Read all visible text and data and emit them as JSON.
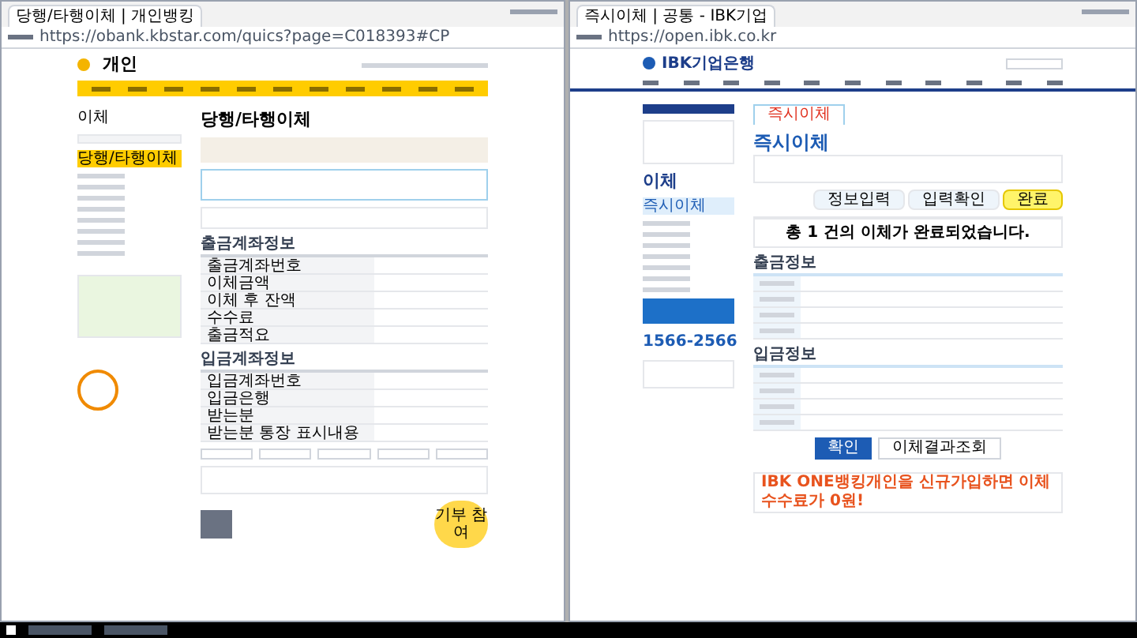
{
  "left_window": {
    "tab_title": "당행/타행이체 | 개인뱅킹",
    "url": "https://obank.kbstar.com/quics?page=C018393#CP",
    "logo": "개인",
    "sidebar_title": "이체",
    "sidebar_items": [
      {
        "label": "당행/타행이체",
        "selected": true
      }
    ],
    "page_title": "당행/타행이체",
    "withdraw": {
      "title": "출금계좌정보",
      "rows": [
        "출금계좌번호",
        "이체금액",
        "이체 후 잔액",
        "수수료",
        "출금적요"
      ]
    },
    "deposit": {
      "title": "입금계좌정보",
      "rows": [
        "입금계좌번호",
        "입금은행",
        "받는분",
        "받는분 통장 표시내용"
      ]
    },
    "donate": "기부 참여"
  },
  "right_window": {
    "tab_title": "즉시이체 | 공통 - IBK기업",
    "url": "https://open.ibk.co.kr",
    "bank_name": "IBK기업은행",
    "page_tab": "즉시이체",
    "page_title": "즉시이체",
    "sidebar_title": "이체",
    "sidebar_items": [
      {
        "label": "즉시이체",
        "selected": true
      }
    ],
    "steps": [
      {
        "label": "정보입력",
        "selected": false
      },
      {
        "label": "입력확인",
        "selected": false
      },
      {
        "label": "완료",
        "selected": true
      }
    ],
    "message": "총 1 건의 이체가 완료되었습니다.",
    "withdraw": {
      "title": "출금정보"
    },
    "deposit": {
      "title": "입금정보"
    },
    "phone": "1566-2566",
    "buttons": [
      {
        "label": "확인",
        "kind": "primary"
      },
      {
        "label": "이체결과조회",
        "kind": "secondary"
      }
    ],
    "banner": "IBK ONE뱅킹개인을 신규가입하면 이체수수료가 0원!"
  }
}
